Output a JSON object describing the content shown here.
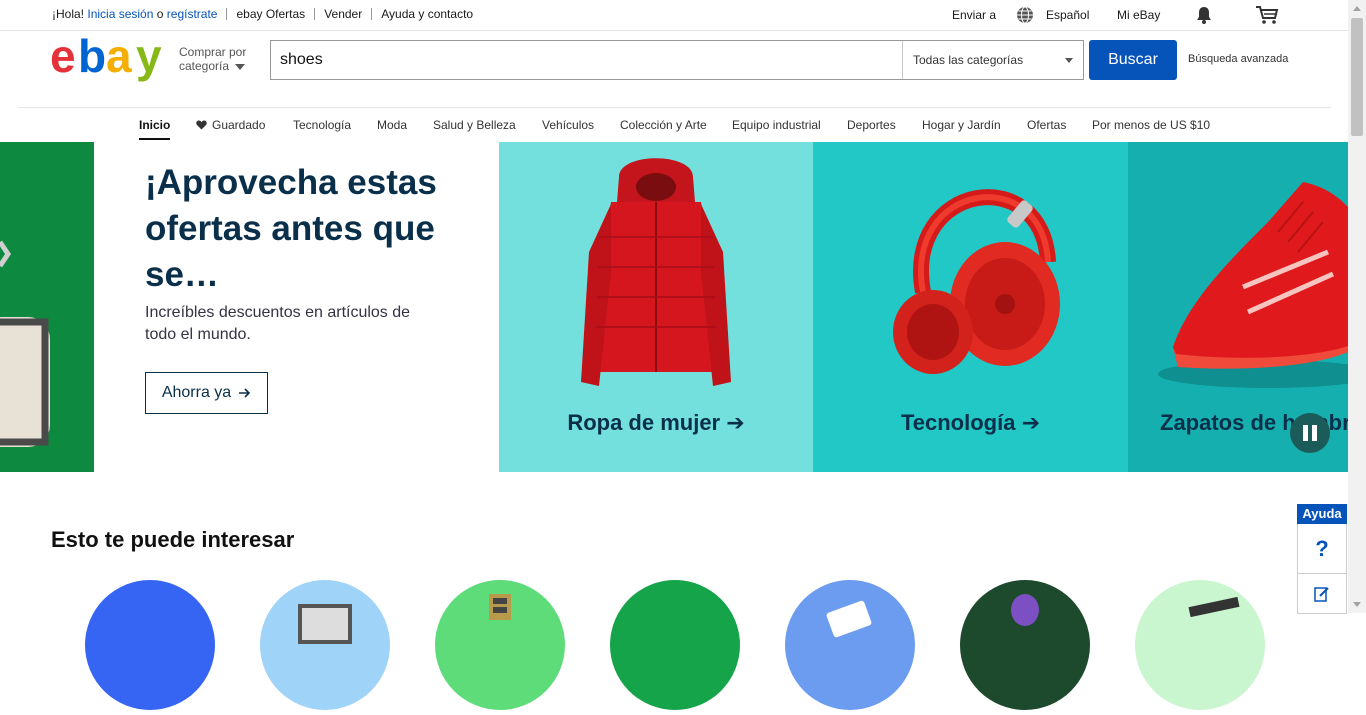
{
  "topbar": {
    "greeting": "¡Hola!",
    "signin": "Inicia sesión",
    "or": "o",
    "register": "regístrate",
    "links": [
      "ebay Ofertas",
      "Vender",
      "Ayuda y contacto"
    ],
    "ship_to": "Enviar a",
    "language": "Español",
    "my_ebay": "Mi eBay"
  },
  "header": {
    "logo_letters": [
      "e",
      "b",
      "a",
      "y"
    ],
    "logo_colors": [
      "#e53238",
      "#0064d2",
      "#f5af02",
      "#86b817"
    ],
    "shop_by_line1": "Comprar por",
    "shop_by_line2": "categoría",
    "search_value": "shoes",
    "category": "Todas las categorías",
    "search_button": "Buscar",
    "advanced": "Búsqueda avanzada"
  },
  "nav": {
    "items": [
      "Inicio",
      "Guardado",
      "Tecnología",
      "Moda",
      "Salud y Belleza",
      "Vehículos",
      "Colección y Arte",
      "Equipo industrial",
      "Deportes",
      "Hogar y Jardín",
      "Ofertas",
      "Por menos de US $10"
    ]
  },
  "hero": {
    "title": "¡Aprovecha estas ofertas antes que se…",
    "subtitle": "Increíbles descuentos en artículos de todo el mundo.",
    "cta": "Ahorra ya",
    "tiles": [
      {
        "label": "Ropa de mujer",
        "bg": "#74e0dd"
      },
      {
        "label": "Tecnología",
        "bg": "#21c8c6"
      },
      {
        "label": "Zapatos de hombre",
        "bg": "#16afb0"
      }
    ]
  },
  "section": {
    "title": "Esto te puede interesar",
    "circle_colors": [
      "#3665f3",
      "#9fd3f7",
      "#5fdc7a",
      "#16a44a",
      "#6c9cf0",
      "#1d4a2c",
      "#c9f5cf"
    ]
  },
  "help": {
    "label": "Ayuda"
  },
  "colors": {
    "brand_blue": "#0654ba",
    "hero_text": "#0a2f4a",
    "hero_green": "#0d8a3f"
  }
}
